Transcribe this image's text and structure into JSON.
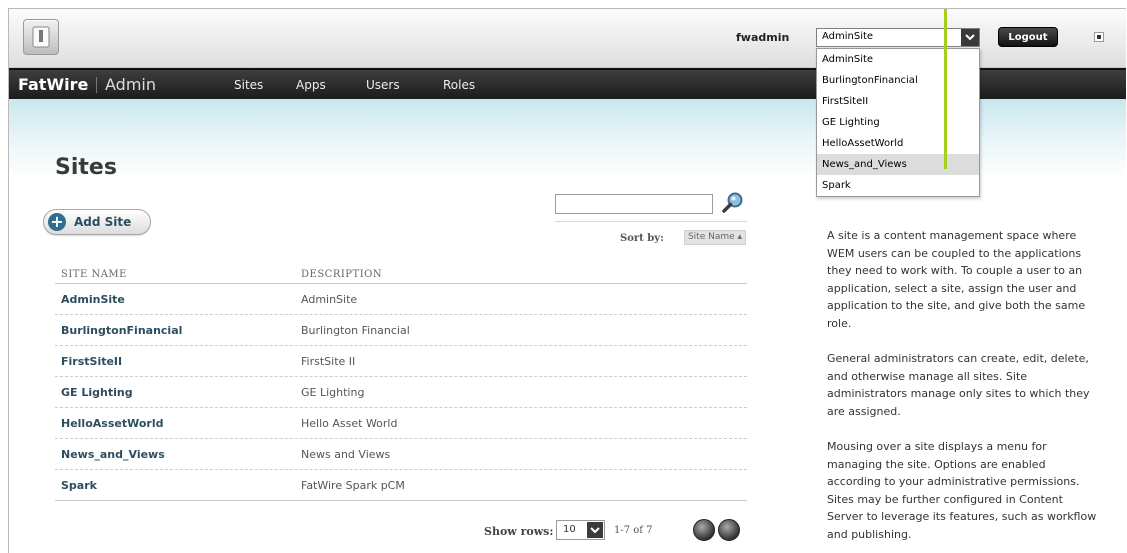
{
  "header": {
    "username": "fwadmin",
    "site_select_value": "AdminSite",
    "logout_label": "Logout"
  },
  "nav": {
    "brand_primary": "FatWire",
    "brand_secondary": "Admin",
    "items": [
      "Sites",
      "Apps",
      "Users",
      "Roles"
    ]
  },
  "page": {
    "title": "Sites",
    "add_button_label": "Add Site",
    "search_placeholder": "",
    "sort_label": "Sort by:",
    "sort_value": "Site Name ▴"
  },
  "table": {
    "headers": [
      "SITE NAME",
      "DESCRIPTION"
    ],
    "rows": [
      {
        "name": "AdminSite",
        "description": "AdminSite"
      },
      {
        "name": "BurlingtonFinancial",
        "description": "Burlington Financial"
      },
      {
        "name": "FirstSiteII",
        "description": "FirstSite II"
      },
      {
        "name": "GE Lighting",
        "description": "GE Lighting"
      },
      {
        "name": "HelloAssetWorld",
        "description": "Hello Asset World"
      },
      {
        "name": "News_and_Views",
        "description": "News and Views"
      },
      {
        "name": "Spark",
        "description": "FatWire Spark pCM"
      }
    ]
  },
  "pager": {
    "show_rows_label": "Show rows:",
    "rows_value": "10",
    "range_text": "1-7 of 7"
  },
  "help": {
    "paragraphs": [
      "A site is a content management space where WEM users can be coupled to the applications they need to work with. To couple a user to an application, select a site, assign the user and application to the site, and give both the same role.",
      "General administrators can create, edit, delete, and otherwise manage all sites. Site administrators manage only sites to which they are assigned.",
      "Mousing over a site displays a menu for managing the site. Options are enabled according to your administrative permissions. Sites may be further configured in Content Server to leverage its features, such as workflow and publishing."
    ]
  },
  "dropdown": {
    "options": [
      "AdminSite",
      "BurlingtonFinancial",
      "FirstSiteII",
      "GE Lighting",
      "HelloAssetWorld",
      "News_and_Views",
      "Spark"
    ],
    "hovered_index": 5
  },
  "colors": {
    "accent_annotation": "#a6cf1c",
    "link": "#2d4d60",
    "nav_bg": "#2a2a2a"
  },
  "icons": [
    "logo-icon",
    "chevron-down-icon",
    "plus-icon",
    "search-icon",
    "prev-page-icon",
    "next-page-icon"
  ]
}
